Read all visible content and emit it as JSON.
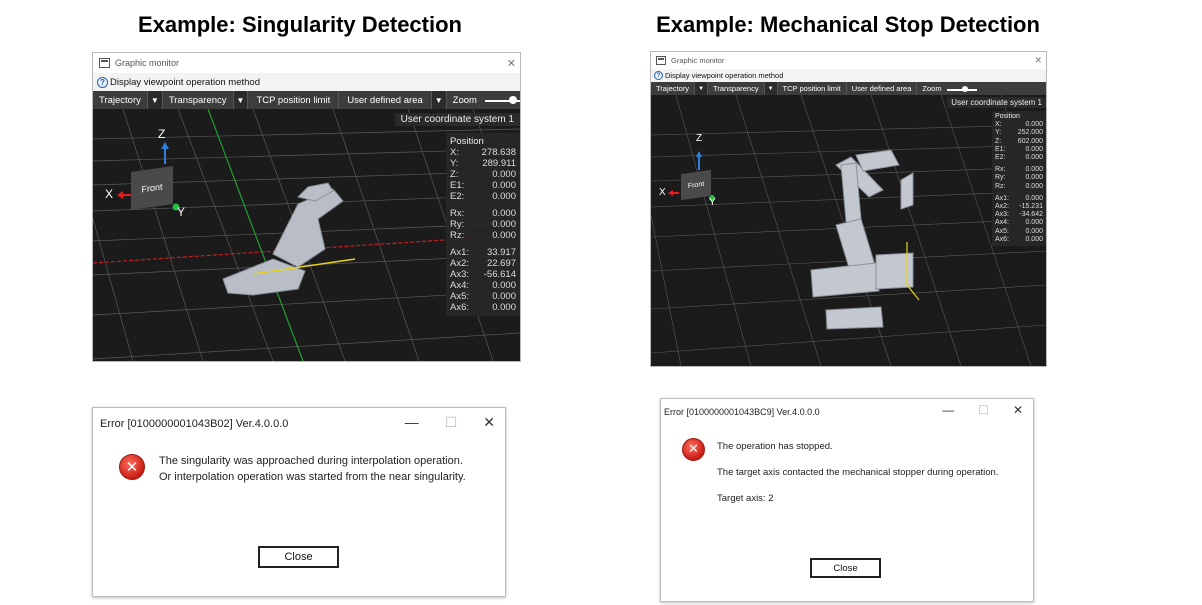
{
  "titles": {
    "left": "Example: Singularity Detection",
    "right": "Example: Mechanical Stop Detection"
  },
  "monitor": {
    "window_title": "Graphic monitor",
    "help_text": "Display viewpoint operation method",
    "toolbar": {
      "trajectory": "Trajectory",
      "transparency": "Transparency",
      "tcp": "TCP position limit",
      "user_area": "User defined area",
      "zoom": "Zoom"
    },
    "coord_system": "User coordinate system 1",
    "position_title": "Position",
    "cube_label": "Front",
    "axes": {
      "z": "Z",
      "x": "X",
      "y": "Y"
    }
  },
  "left_monitor": {
    "zoom_level": 0.8,
    "pos_xyz": [
      {
        "k": "X:",
        "v": "278.638"
      },
      {
        "k": "Y:",
        "v": "289.911"
      },
      {
        "k": "Z:",
        "v": "0.000"
      },
      {
        "k": "E1:",
        "v": "0.000"
      },
      {
        "k": "E2:",
        "v": "0.000"
      }
    ],
    "pos_rot": [
      {
        "k": "Rx:",
        "v": "0.000"
      },
      {
        "k": "Ry:",
        "v": "0.000"
      },
      {
        "k": "Rz:",
        "v": "0.000"
      }
    ],
    "pos_axes": [
      {
        "k": "Ax1:",
        "v": "33.917"
      },
      {
        "k": "Ax2:",
        "v": "22.697"
      },
      {
        "k": "Ax3:",
        "v": "-56.614"
      },
      {
        "k": "Ax4:",
        "v": "0.000"
      },
      {
        "k": "Ax5:",
        "v": "0.000"
      },
      {
        "k": "Ax6:",
        "v": "0.000"
      }
    ]
  },
  "right_monitor": {
    "zoom_level": 0.6,
    "pos_xyz": [
      {
        "k": "X:",
        "v": "0.000"
      },
      {
        "k": "Y:",
        "v": "252.000"
      },
      {
        "k": "Z:",
        "v": "602.000"
      },
      {
        "k": "E1:",
        "v": "0.000"
      },
      {
        "k": "E2:",
        "v": "0.000"
      }
    ],
    "pos_rot": [
      {
        "k": "Rx:",
        "v": "0.000"
      },
      {
        "k": "Ry:",
        "v": "0.000"
      },
      {
        "k": "Rz:",
        "v": "0.000"
      }
    ],
    "pos_axes": [
      {
        "k": "Ax1:",
        "v": "0.000"
      },
      {
        "k": "Ax2:",
        "v": "-15.231"
      },
      {
        "k": "Ax3:",
        "v": "-34.642"
      },
      {
        "k": "Ax4:",
        "v": "0.000"
      },
      {
        "k": "Ax5:",
        "v": "0.000"
      },
      {
        "k": "Ax6:",
        "v": "0.000"
      }
    ]
  },
  "left_dialog": {
    "title": "Error [0100000001043B02] Ver.4.0.0.0",
    "line1": "The singularity was approached during interpolation operation.",
    "line2": "Or interpolation operation was started from the near singularity.",
    "close_label": "Close"
  },
  "right_dialog": {
    "title": "Error [0100000001043BC9] Ver.4.0.0.0",
    "line1": "The operation has stopped.",
    "line2": "The target axis contacted the mechanical stopper during operation.",
    "line3": "Target axis: 2",
    "close_label": "Close"
  },
  "window_controls": {
    "minimize": "—",
    "maximize": "☐",
    "close": "✕"
  },
  "colors": {
    "error_red": "#d9251b",
    "axis_x": "#e02020",
    "axis_y": "#20c040",
    "axis_z": "#2f7fd6",
    "grid_x": "#c02020",
    "grid_y": "#20a030"
  }
}
